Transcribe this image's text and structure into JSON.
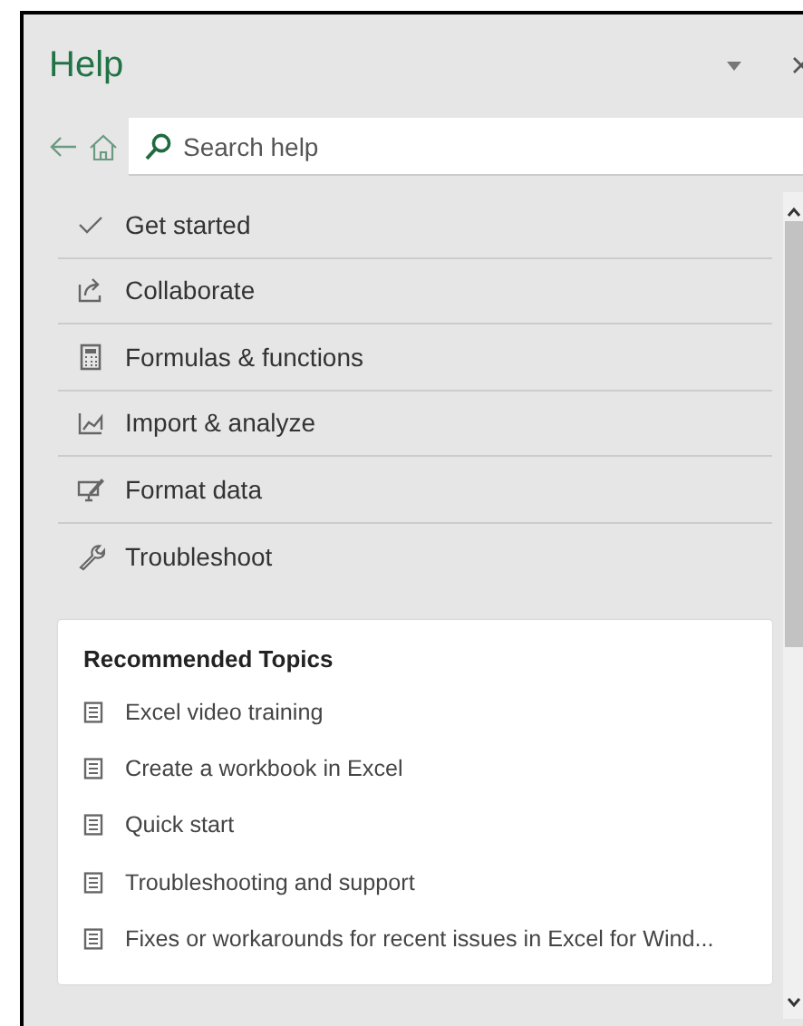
{
  "panel": {
    "title": "Help"
  },
  "search": {
    "placeholder": "Search help"
  },
  "categories": [
    {
      "label": "Get started"
    },
    {
      "label": "Collaborate"
    },
    {
      "label": "Formulas & functions"
    },
    {
      "label": "Import & analyze"
    },
    {
      "label": "Format data"
    },
    {
      "label": "Troubleshoot"
    }
  ],
  "recommended": {
    "title": "Recommended Topics",
    "items": [
      {
        "label": "Excel video training"
      },
      {
        "label": "Create a workbook in Excel"
      },
      {
        "label": "Quick start"
      },
      {
        "label": "Troubleshooting and support"
      },
      {
        "label": "Fixes or workarounds for recent issues in Excel for Wind..."
      }
    ]
  }
}
